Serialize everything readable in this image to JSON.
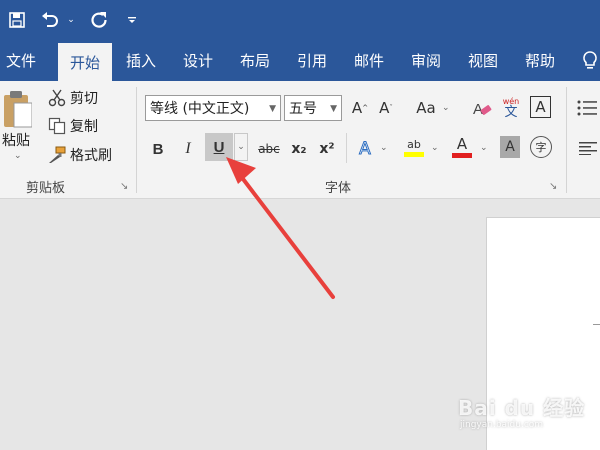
{
  "quick_access": {
    "save_icon": "save-icon",
    "undo_icon": "undo-icon",
    "redo_icon": "redo-icon",
    "customize_icon": "customize-qat-icon"
  },
  "tabs": [
    {
      "label": "文件"
    },
    {
      "label": "开始"
    },
    {
      "label": "插入"
    },
    {
      "label": "设计"
    },
    {
      "label": "布局"
    },
    {
      "label": "引用"
    },
    {
      "label": "邮件"
    },
    {
      "label": "审阅"
    },
    {
      "label": "视图"
    },
    {
      "label": "帮助"
    }
  ],
  "clipboard": {
    "paste_label": "粘贴",
    "cut_label": "剪切",
    "copy_label": "复制",
    "format_painter_label": "格式刷",
    "group_label": "剪贴板"
  },
  "font": {
    "font_name": "等线 (中文正文)",
    "font_size": "五号",
    "bold": "B",
    "italic": "I",
    "underline": "U",
    "strikethrough": "abc",
    "subscript": "x₂",
    "superscript": "x²",
    "grow": "A",
    "shrink": "A",
    "change_case": "Aa",
    "phonetic_top": "wén",
    "phonetic_bottom": "文",
    "char_border": "A",
    "text_effects": "A",
    "highlight": "ab",
    "font_color": "A",
    "char_shading": "A",
    "enclose": "字",
    "group_label": "字体"
  },
  "colors": {
    "ribbon_blue": "#2b579a",
    "highlight_yellow": "#ffff00",
    "font_color_red": "#e11f1f",
    "arrow_red": "#e8403c"
  },
  "watermark": {
    "text": "Bai du 经验",
    "sub": "jingyan.baidu.com"
  }
}
